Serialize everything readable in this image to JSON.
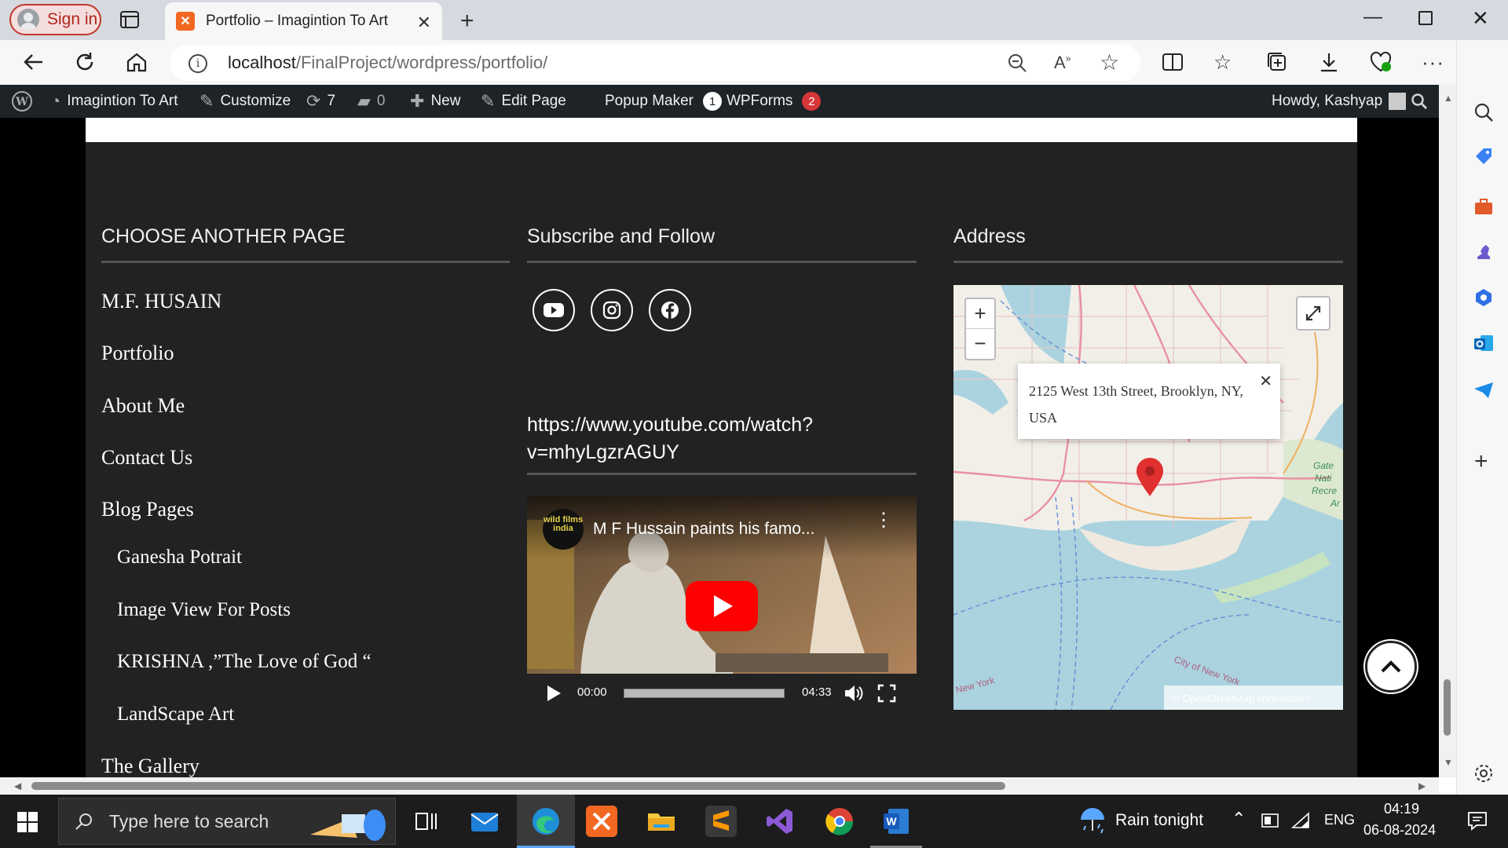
{
  "browser": {
    "signin_label": "Sign in",
    "tab_title": "Portfolio – Imagintion To Art",
    "url_host": "localhost",
    "url_path": "/FinalProject/wordpress/portfolio/"
  },
  "admin_bar": {
    "site_name": "Imagintion To Art",
    "customize": "Customize",
    "updates_count": "7",
    "comments_count": "0",
    "new_label": "New",
    "edit_page": "Edit Page",
    "popup_maker": "Popup Maker",
    "popup_maker_count": "1",
    "wpforms": "WPForms",
    "wpforms_count": "2",
    "howdy": "Howdy, Kashyap"
  },
  "footer": {
    "menu_title": "CHOOSE ANOTHER PAGE",
    "menu_items": [
      "M.F. HUSAIN",
      "Portfolio",
      "About Me",
      "Contact Us",
      "Blog Pages"
    ],
    "sub_items": [
      "Ganesha Potrait",
      "Image View For Posts",
      "KRISHNA ,”The Love of God “",
      "LandScape Art"
    ],
    "last_item": "The Gallery",
    "subscribe_title": "Subscribe and Follow",
    "social_icons": [
      "youtube-icon",
      "instagram-icon",
      "facebook-icon"
    ],
    "youtube_link": "https://www.youtube.com/watch?v=mhyLgzrAGUY",
    "address_title": "Address"
  },
  "video": {
    "channel_badge": "wild films india",
    "title": "M F Hussain paints his famo...",
    "current_time": "00:00",
    "duration": "04:33"
  },
  "map": {
    "popup_text": "2125 West 13th Street, Brooklyn, NY, USA",
    "attribution": "© OpenStreetMap contributors",
    "labels": [
      "City of New York",
      "New York",
      "Gate Nati Recre Ar"
    ]
  },
  "taskbar": {
    "search_placeholder": "Type here to search",
    "weather": "Rain tonight",
    "lang": "ENG",
    "time": "04:19",
    "date": "06-08-2024"
  },
  "colors": {
    "footer_bg": "#222222",
    "admin_bar_bg": "#1d2327",
    "badge_popup": "#ffffff",
    "badge_wpforms": "#d63638",
    "signin_red": "#b0251c"
  }
}
